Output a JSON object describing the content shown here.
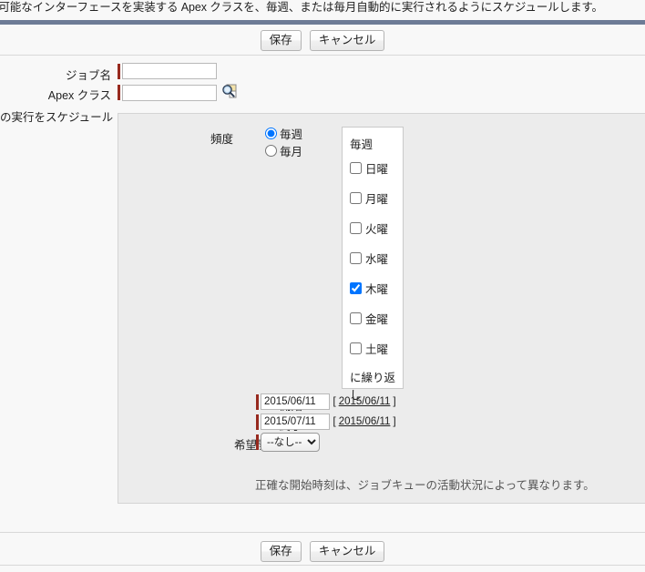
{
  "page": {
    "description": "ウ可能なインターフェースを実装する Apex クラスを、毎週、または毎月自動的に実行されるようにスケジュールします。"
  },
  "toolbar_top": {
    "save_label": "保存",
    "cancel_label": "キャンセル"
  },
  "toolbar_bottom": {
    "save_label": "保存",
    "cancel_label": "キャンセル"
  },
  "form": {
    "job_name": {
      "label": "ジョブ名",
      "value": "",
      "placeholder": ""
    },
    "apex_class": {
      "label": "Apex クラス",
      "value": "",
      "placeholder": "",
      "lookup_icon": "lookup-search-icon"
    },
    "schedule_section": {
      "label": "の実行をスケジュール"
    }
  },
  "frequency": {
    "label": "頻度",
    "options": [
      {
        "label": "毎週",
        "value": "weekly",
        "selected": true
      },
      {
        "label": "毎月",
        "value": "monthly",
        "selected": false
      }
    ],
    "weekly_panel": {
      "title": "毎週",
      "days": [
        {
          "label": "日曜",
          "checked": false
        },
        {
          "label": "月曜",
          "checked": false
        },
        {
          "label": "火曜",
          "checked": false
        },
        {
          "label": "水曜",
          "checked": false
        },
        {
          "label": "木曜",
          "checked": true
        },
        {
          "label": "金曜",
          "checked": false
        },
        {
          "label": "土曜",
          "checked": false
        }
      ],
      "footer": "に繰り返し"
    }
  },
  "dates": {
    "start": {
      "label": "開始",
      "value": "2015/06/11",
      "link_open": "[",
      "link_text": "2015/06/11",
      "link_close": "]"
    },
    "end": {
      "label": "終了",
      "value": "2015/07/11",
      "link_open": "[",
      "link_text": "2015/06/11",
      "link_close": "]"
    },
    "preferred_start_time": {
      "label": "希望開始時刻",
      "selected": "--なし--",
      "options": [
        "--なし--"
      ]
    }
  },
  "note": "正確な開始時刻は、ジョブキューの活動状況によって異なります。",
  "colors": {
    "divider_blue": "#6d7b96",
    "required_marker": "#97291e",
    "panel_bg": "#ececec",
    "page_bg": "#f8f8f8"
  }
}
